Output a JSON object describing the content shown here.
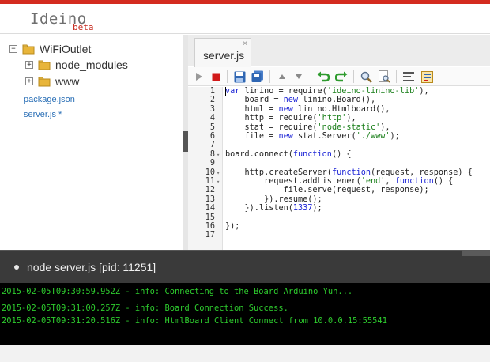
{
  "app": {
    "name": "Ideino",
    "badge": "beta"
  },
  "sidebar": {
    "root": {
      "label": "WiFiOutlet",
      "toggle": "−"
    },
    "folders": [
      {
        "label": "node_modules",
        "toggle": "+"
      },
      {
        "label": "www",
        "toggle": "+"
      }
    ],
    "files": [
      {
        "label": "package.json"
      },
      {
        "label": "server.js *"
      }
    ]
  },
  "editor": {
    "tab": {
      "label": "server.js",
      "close": "×"
    },
    "toolbar_icons": [
      "run-icon",
      "stop-icon",
      "save-icon",
      "save-all-icon",
      "arrow-up-icon",
      "arrow-down-icon",
      "undo-icon",
      "redo-icon",
      "search-icon",
      "replace-icon",
      "format-icon",
      "settings-icon"
    ],
    "code_lines": [
      {
        "n": "1",
        "fold": "",
        "code": "var linino = require('ideino-linino-lib'),",
        "segs": [
          [
            "kw",
            "var"
          ],
          [
            "t",
            " linino = require("
          ],
          [
            "str",
            "'ideino-linino-lib'"
          ],
          [
            "t",
            "),"
          ]
        ]
      },
      {
        "n": "2",
        "fold": "",
        "code": "    board = new linino.Board(),",
        "segs": [
          [
            "t",
            "    board = "
          ],
          [
            "kw",
            "new"
          ],
          [
            "t",
            " linino.Board(),"
          ]
        ]
      },
      {
        "n": "3",
        "fold": "",
        "code": "    html = new linino.Htmlboard(),",
        "segs": [
          [
            "t",
            "    html = "
          ],
          [
            "kw",
            "new"
          ],
          [
            "t",
            " linino.Htmlboard(),"
          ]
        ]
      },
      {
        "n": "4",
        "fold": "",
        "code": "    http = require('http'),",
        "segs": [
          [
            "t",
            "    http = require("
          ],
          [
            "str",
            "'http'"
          ],
          [
            "t",
            "),"
          ]
        ]
      },
      {
        "n": "5",
        "fold": "",
        "code": "    stat = require('node-static'),",
        "segs": [
          [
            "t",
            "    stat = require("
          ],
          [
            "str",
            "'node-static'"
          ],
          [
            "t",
            "),"
          ]
        ]
      },
      {
        "n": "6",
        "fold": "",
        "code": "    file = new stat.Server('./www');",
        "segs": [
          [
            "t",
            "    file = "
          ],
          [
            "kw",
            "new"
          ],
          [
            "t",
            " stat.Server("
          ],
          [
            "str",
            "'./www'"
          ],
          [
            "t",
            ");"
          ]
        ]
      },
      {
        "n": "7",
        "fold": "",
        "code": "",
        "segs": []
      },
      {
        "n": "8",
        "fold": "▾",
        "code": "board.connect(function() {",
        "segs": [
          [
            "t",
            "board.connect("
          ],
          [
            "kw",
            "function"
          ],
          [
            "t",
            "() {"
          ]
        ]
      },
      {
        "n": "9",
        "fold": "",
        "code": "",
        "segs": []
      },
      {
        "n": "10",
        "fold": "▾",
        "code": "    http.createServer(function(request, response) {",
        "segs": [
          [
            "t",
            "    http.createServer("
          ],
          [
            "kw",
            "function"
          ],
          [
            "t",
            "(request, response) {"
          ]
        ]
      },
      {
        "n": "11",
        "fold": "▾",
        "code": "        request.addListener('end', function() {",
        "segs": [
          [
            "t",
            "        request.addListener("
          ],
          [
            "str",
            "'end'"
          ],
          [
            "t",
            ", "
          ],
          [
            "kw",
            "function"
          ],
          [
            "t",
            "() {"
          ]
        ]
      },
      {
        "n": "12",
        "fold": "",
        "code": "            file.serve(request, response);",
        "segs": [
          [
            "t",
            "            file.serve(request, response);"
          ]
        ]
      },
      {
        "n": "13",
        "fold": "",
        "code": "        }).resume();",
        "segs": [
          [
            "t",
            "        }).resume();"
          ]
        ]
      },
      {
        "n": "14",
        "fold": "",
        "code": "    }).listen(1337);",
        "segs": [
          [
            "t",
            "    }).listen("
          ],
          [
            "num",
            "1337"
          ],
          [
            "t",
            ");"
          ]
        ]
      },
      {
        "n": "15",
        "fold": "",
        "code": "",
        "segs": []
      },
      {
        "n": "16",
        "fold": "",
        "code": "});",
        "segs": [
          [
            "t",
            "});"
          ]
        ]
      },
      {
        "n": "17",
        "fold": "",
        "code": "",
        "segs": []
      }
    ]
  },
  "console": {
    "title": "node server.js [pid: 11251]",
    "lines": [
      "2015-02-05T09:30:59.952Z - info: Connecting to the Board Arduino Yun...",
      "2015-02-05T09:31:00.257Z - info: Board Connection Success.",
      "2015-02-05T09:31:20.516Z - info: HtmlBoard Client Connect from 10.0.0.15:55541"
    ]
  },
  "colors": {
    "brand_red": "#d42b20",
    "console_green": "#2ecc2e",
    "keyword_blue": "#1c24d6",
    "string_green": "#1a7f1a"
  }
}
